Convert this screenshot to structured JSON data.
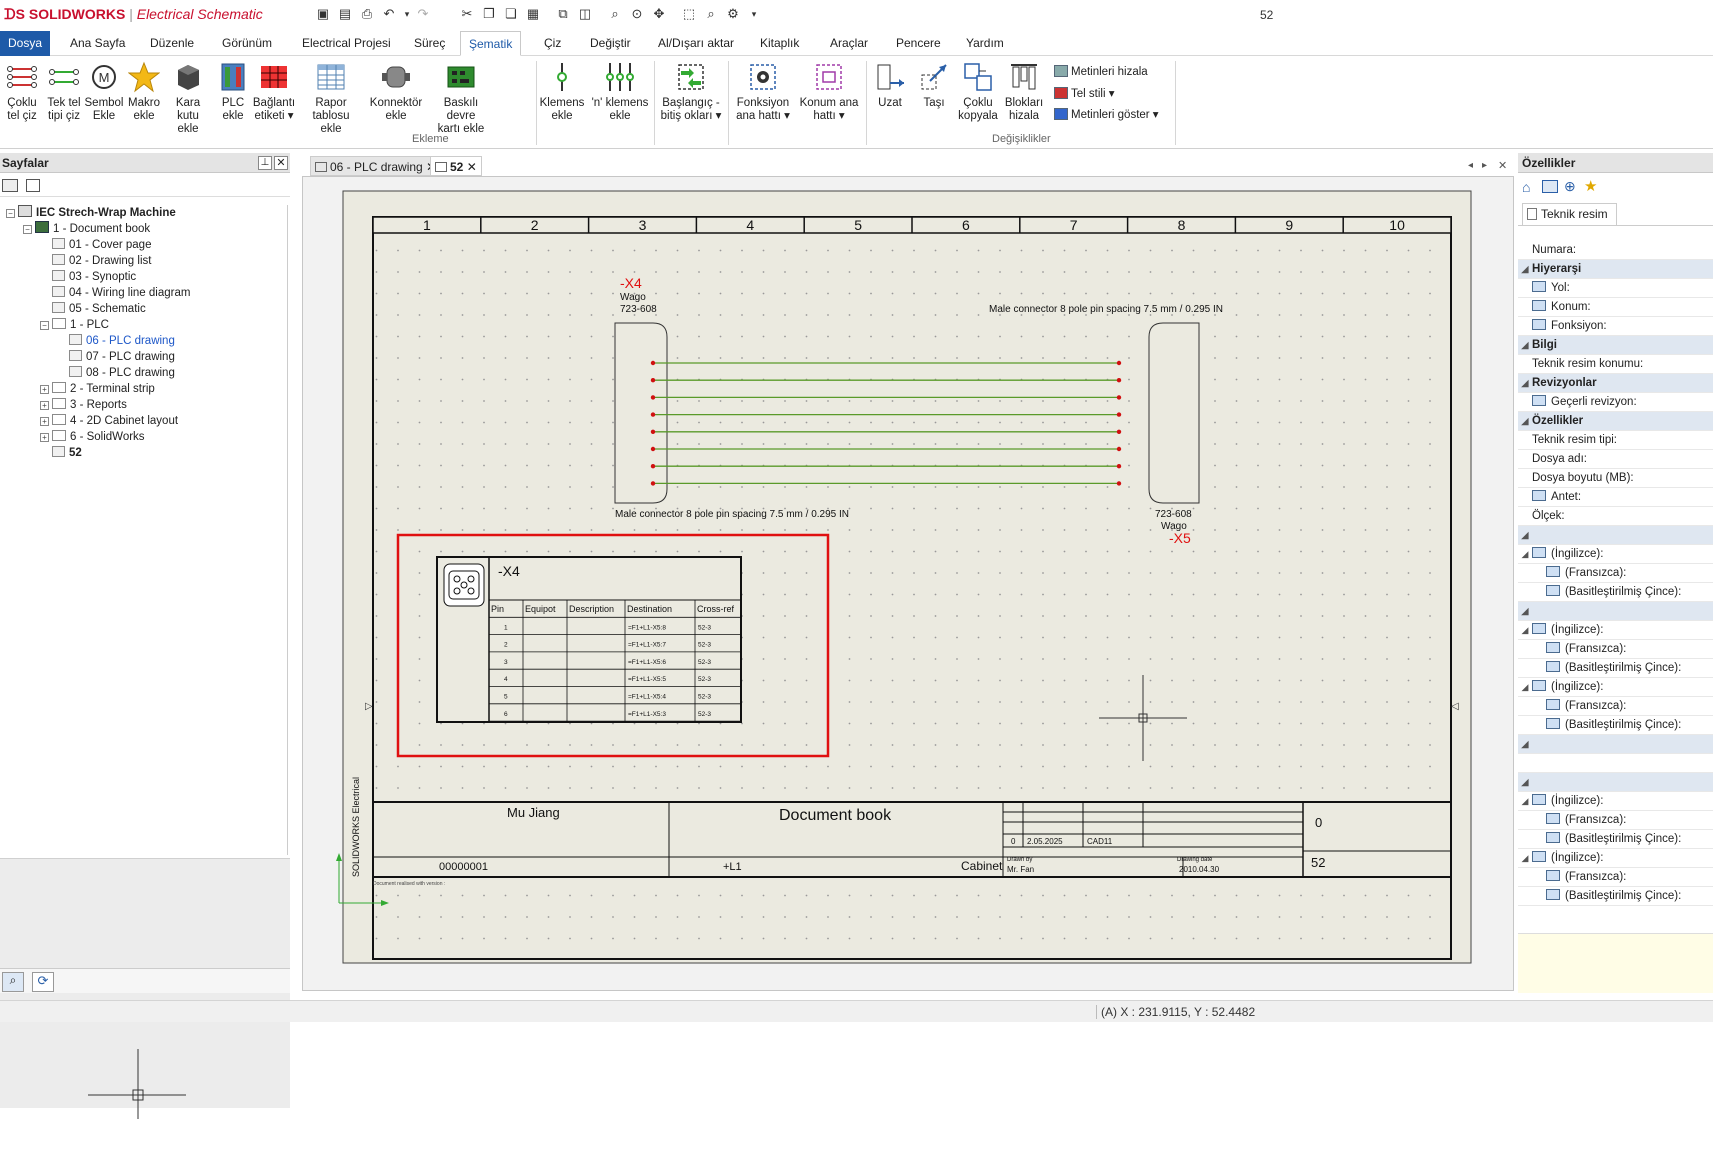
{
  "app": {
    "brand": "SOLIDWORKS",
    "product": "Electrical Schematic",
    "title_number": "52"
  },
  "menu": [
    "Dosya",
    "Ana Sayfa",
    "Düzenle",
    "Görünüm",
    "Electrical Projesi",
    "Süreç",
    "Şematik",
    "Çiz",
    "Değiştir",
    "Al/Dışarı aktar",
    "Kitaplık",
    "Araçlar",
    "Pencere",
    "Yardım"
  ],
  "ribbon": {
    "buttons": [
      {
        "l1": "Çoklu",
        "l2": "tel çiz"
      },
      {
        "l1": "Tek tel",
        "l2": "tipi çiz"
      },
      {
        "l1": "Sembol",
        "l2": "Ekle"
      },
      {
        "l1": "Makro",
        "l2": "ekle"
      },
      {
        "l1": "Kara kutu",
        "l2": "ekle"
      },
      {
        "l1": "PLC",
        "l2": "ekle"
      },
      {
        "l1": "Bağlantı",
        "l2": "etiketi ▾"
      },
      {
        "l1": "Rapor tablosu",
        "l2": "ekle"
      },
      {
        "l1": "Konnektör",
        "l2": "ekle"
      },
      {
        "l1": "Baskılı devre",
        "l2": "kartı ekle"
      },
      {
        "l1": "Klemens",
        "l2": "ekle"
      },
      {
        "l1": "'n' klemens",
        "l2": "ekle"
      },
      {
        "l1": "Başlangıç -",
        "l2": "bitiş okları ▾"
      },
      {
        "l1": "Fonksiyon",
        "l2": "ana hattı ▾"
      },
      {
        "l1": "Konum ana",
        "l2": "hattı ▾"
      },
      {
        "l1": "Uzat",
        "l2": ""
      },
      {
        "l1": "Taşı",
        "l2": ""
      },
      {
        "l1": "Çoklu",
        "l2": "kopyala"
      },
      {
        "l1": "Blokları",
        "l2": "hizala"
      }
    ],
    "small": [
      "Metinleri hizala",
      "Tel stili ▾",
      "Metinleri göster ▾"
    ],
    "groups": [
      "Ekleme",
      "Değişiklikler"
    ]
  },
  "left_panel": {
    "title": "Sayfalar",
    "tree": [
      {
        "text": "IEC Strech-Wrap Machine",
        "indent": 0,
        "pm": "−",
        "icon": "pr",
        "bold": true
      },
      {
        "text": "1 - Document book",
        "indent": 1,
        "pm": "−",
        "icon": "bk"
      },
      {
        "text": "01 - Cover page",
        "indent": 2,
        "pm": "",
        "icon": "fi"
      },
      {
        "text": "02 - Drawing list",
        "indent": 2,
        "pm": "",
        "icon": "fi"
      },
      {
        "text": "03 - Synoptic",
        "indent": 2,
        "pm": "",
        "icon": "fi"
      },
      {
        "text": "04 - Wiring line diagram",
        "indent": 2,
        "pm": "",
        "icon": "fi"
      },
      {
        "text": "05 - Schematic",
        "indent": 2,
        "pm": "",
        "icon": "fi"
      },
      {
        "text": "1 - PLC",
        "indent": 2,
        "pm": "−",
        "icon": "fo"
      },
      {
        "text": "06 - PLC drawing",
        "indent": 3,
        "pm": "",
        "icon": "fi",
        "link": true
      },
      {
        "text": "07 - PLC drawing",
        "indent": 3,
        "pm": "",
        "icon": "fi"
      },
      {
        "text": "08 - PLC drawing",
        "indent": 3,
        "pm": "",
        "icon": "fi"
      },
      {
        "text": "2 - Terminal strip",
        "indent": 2,
        "pm": "+",
        "icon": "fo"
      },
      {
        "text": "3 - Reports",
        "indent": 2,
        "pm": "+",
        "icon": "fo"
      },
      {
        "text": "4 - 2D Cabinet layout",
        "indent": 2,
        "pm": "+",
        "icon": "fo"
      },
      {
        "text": "6 - SolidWorks",
        "indent": 2,
        "pm": "+",
        "icon": "fo"
      },
      {
        "text": "52",
        "indent": 2,
        "pm": "",
        "icon": "fi",
        "bold": true
      }
    ]
  },
  "doc_tabs": [
    "06 - PLC drawing",
    "52"
  ],
  "drawing": {
    "columns": [
      "1",
      "2",
      "3",
      "4",
      "5",
      "6",
      "7",
      "8",
      "9",
      "10"
    ],
    "x4": {
      "tag": "-X4",
      "maker": "Wago",
      "ref": "723-608",
      "desc": "Male connector 8 pole pin spacing 7.5 mm / 0.295 IN"
    },
    "x5": {
      "tag": "-X5",
      "maker": "Wago",
      "ref": "723-608",
      "desc": "Male connector 8 pole pin spacing 7.5 mm / 0.295 IN"
    },
    "table": {
      "tag": "-X4",
      "headers": [
        "Pin",
        "Equipot",
        "Description",
        "Destination",
        "Cross-ref"
      ],
      "rows": [
        [
          "1",
          "",
          "",
          "=F1+L1-X5:8",
          "52-3"
        ],
        [
          "2",
          "",
          "",
          "=F1+L1-X5:7",
          "52-3"
        ],
        [
          "3",
          "",
          "",
          "=F1+L1-X5:6",
          "52-3"
        ],
        [
          "4",
          "",
          "",
          "=F1+L1-X5:5",
          "52-3"
        ],
        [
          "5",
          "",
          "",
          "=F1+L1-X5:4",
          "52-3"
        ],
        [
          "6",
          "",
          "",
          "=F1+L1-X5:3",
          "52-3"
        ]
      ]
    },
    "titleblock": {
      "author": "Mu Jiang",
      "title": "Document book",
      "code": "00000001",
      "location": "+L1",
      "cabinet": "Cabinet",
      "rev_index": "0",
      "rev_date": "2.05.2025",
      "rev_by": "CAD11",
      "drawn_by_label": "Drawn by",
      "drawn_by": "Mr. Fan",
      "drawing_date_label": "Drawing date",
      "drawing_date": "2010.04.30",
      "rev": "0",
      "page": "52",
      "side_text": "SOLIDWORKS Electrical",
      "footer_text": "Document realised with version :"
    },
    "highlight_color": "#e01010",
    "wire_color": "#5a9a2a"
  },
  "right_panel": {
    "title": "Özellikler",
    "tab": "Teknik resim",
    "rows": [
      {
        "t": "Numara:",
        "k": "plain"
      },
      {
        "t": "Hiyerarşi",
        "k": "cat"
      },
      {
        "t": "Yol:",
        "k": "icon"
      },
      {
        "t": "Konum:",
        "k": "icon"
      },
      {
        "t": "Fonksiyon:",
        "k": "icon"
      },
      {
        "t": "Bilgi",
        "k": "cat"
      },
      {
        "t": "Teknik resim konumu:",
        "k": "plain"
      },
      {
        "t": "Revizyonlar",
        "k": "cat"
      },
      {
        "t": "Geçerli revizyon:",
        "k": "icon"
      },
      {
        "t": "Özellikler",
        "k": "cat"
      },
      {
        "t": "Teknik resim tipi:",
        "k": "plain"
      },
      {
        "t": "Dosya adı:",
        "k": "plain"
      },
      {
        "t": "Dosya boyutu (MB):",
        "k": "plain"
      },
      {
        "t": "Antet:",
        "k": "icon"
      },
      {
        "t": "Ölçek:",
        "k": "plain"
      },
      {
        "t": "",
        "k": "cat"
      },
      {
        "t": "(İngilizce):",
        "k": "lang"
      },
      {
        "t": "(Fransızca):",
        "k": "sub"
      },
      {
        "t": "(Basitleştirilmiş Çince):",
        "k": "sub"
      },
      {
        "t": "",
        "k": "cat"
      },
      {
        "t": "(İngilizce):",
        "k": "lang"
      },
      {
        "t": "(Fransızca):",
        "k": "sub"
      },
      {
        "t": "(Basitleştirilmiş Çince):",
        "k": "sub"
      },
      {
        "t": "(İngilizce):",
        "k": "lang"
      },
      {
        "t": "(Fransızca):",
        "k": "sub"
      },
      {
        "t": "(Basitleştirilmiş Çince):",
        "k": "sub"
      },
      {
        "t": "",
        "k": "cat"
      },
      {
        "t": "",
        "k": "plain"
      },
      {
        "t": "",
        "k": "cat"
      },
      {
        "t": "(İngilizce):",
        "k": "lang"
      },
      {
        "t": "(Fransızca):",
        "k": "sub"
      },
      {
        "t": "(Basitleştirilmiş Çince):",
        "k": "sub"
      },
      {
        "t": "(İngilizce):",
        "k": "lang"
      },
      {
        "t": "(Fransızca):",
        "k": "sub"
      },
      {
        "t": "(Basitleştirilmiş Çince):",
        "k": "sub"
      }
    ]
  },
  "status": {
    "coords": "(A) X : 231.9115, Y : 52.4482"
  }
}
